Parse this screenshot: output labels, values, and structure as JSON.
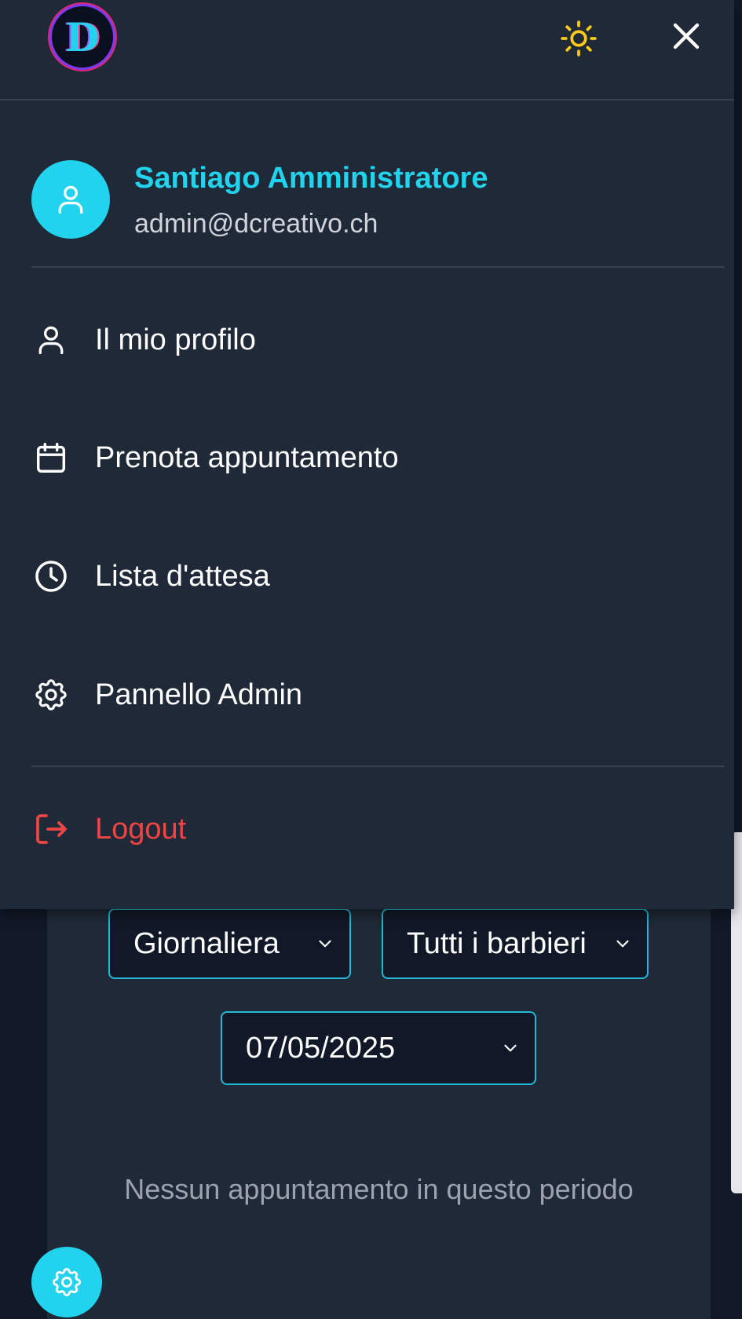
{
  "header": {
    "logo_letter": "D",
    "theme_icon": "sun-icon",
    "close_icon": "close-icon"
  },
  "user": {
    "name": "Santiago Amministratore",
    "email": "admin@dcreativo.ch",
    "avatar_icon": "user-icon"
  },
  "menu": {
    "items": [
      {
        "label": "Il mio profilo",
        "icon": "user-icon"
      },
      {
        "label": "Prenota appuntamento",
        "icon": "calendar-icon"
      },
      {
        "label": "Lista d'attesa",
        "icon": "clock-icon"
      },
      {
        "label": "Pannello Admin",
        "icon": "gear-icon"
      }
    ],
    "logout_label": "Logout",
    "logout_icon": "logout-icon"
  },
  "filters": {
    "period_value": "Giornaliera",
    "barber_value": "Tutti i barbieri",
    "date_value": "07/05/2025"
  },
  "main": {
    "empty_message": "Nessun appuntamento in questo periodo"
  },
  "fab": {
    "icon": "gear-icon"
  },
  "colors": {
    "accent": "#22d3ee",
    "drawer_bg": "#1f2937",
    "page_bg": "#111827",
    "danger": "#ef4444",
    "sun": "#facc15"
  }
}
